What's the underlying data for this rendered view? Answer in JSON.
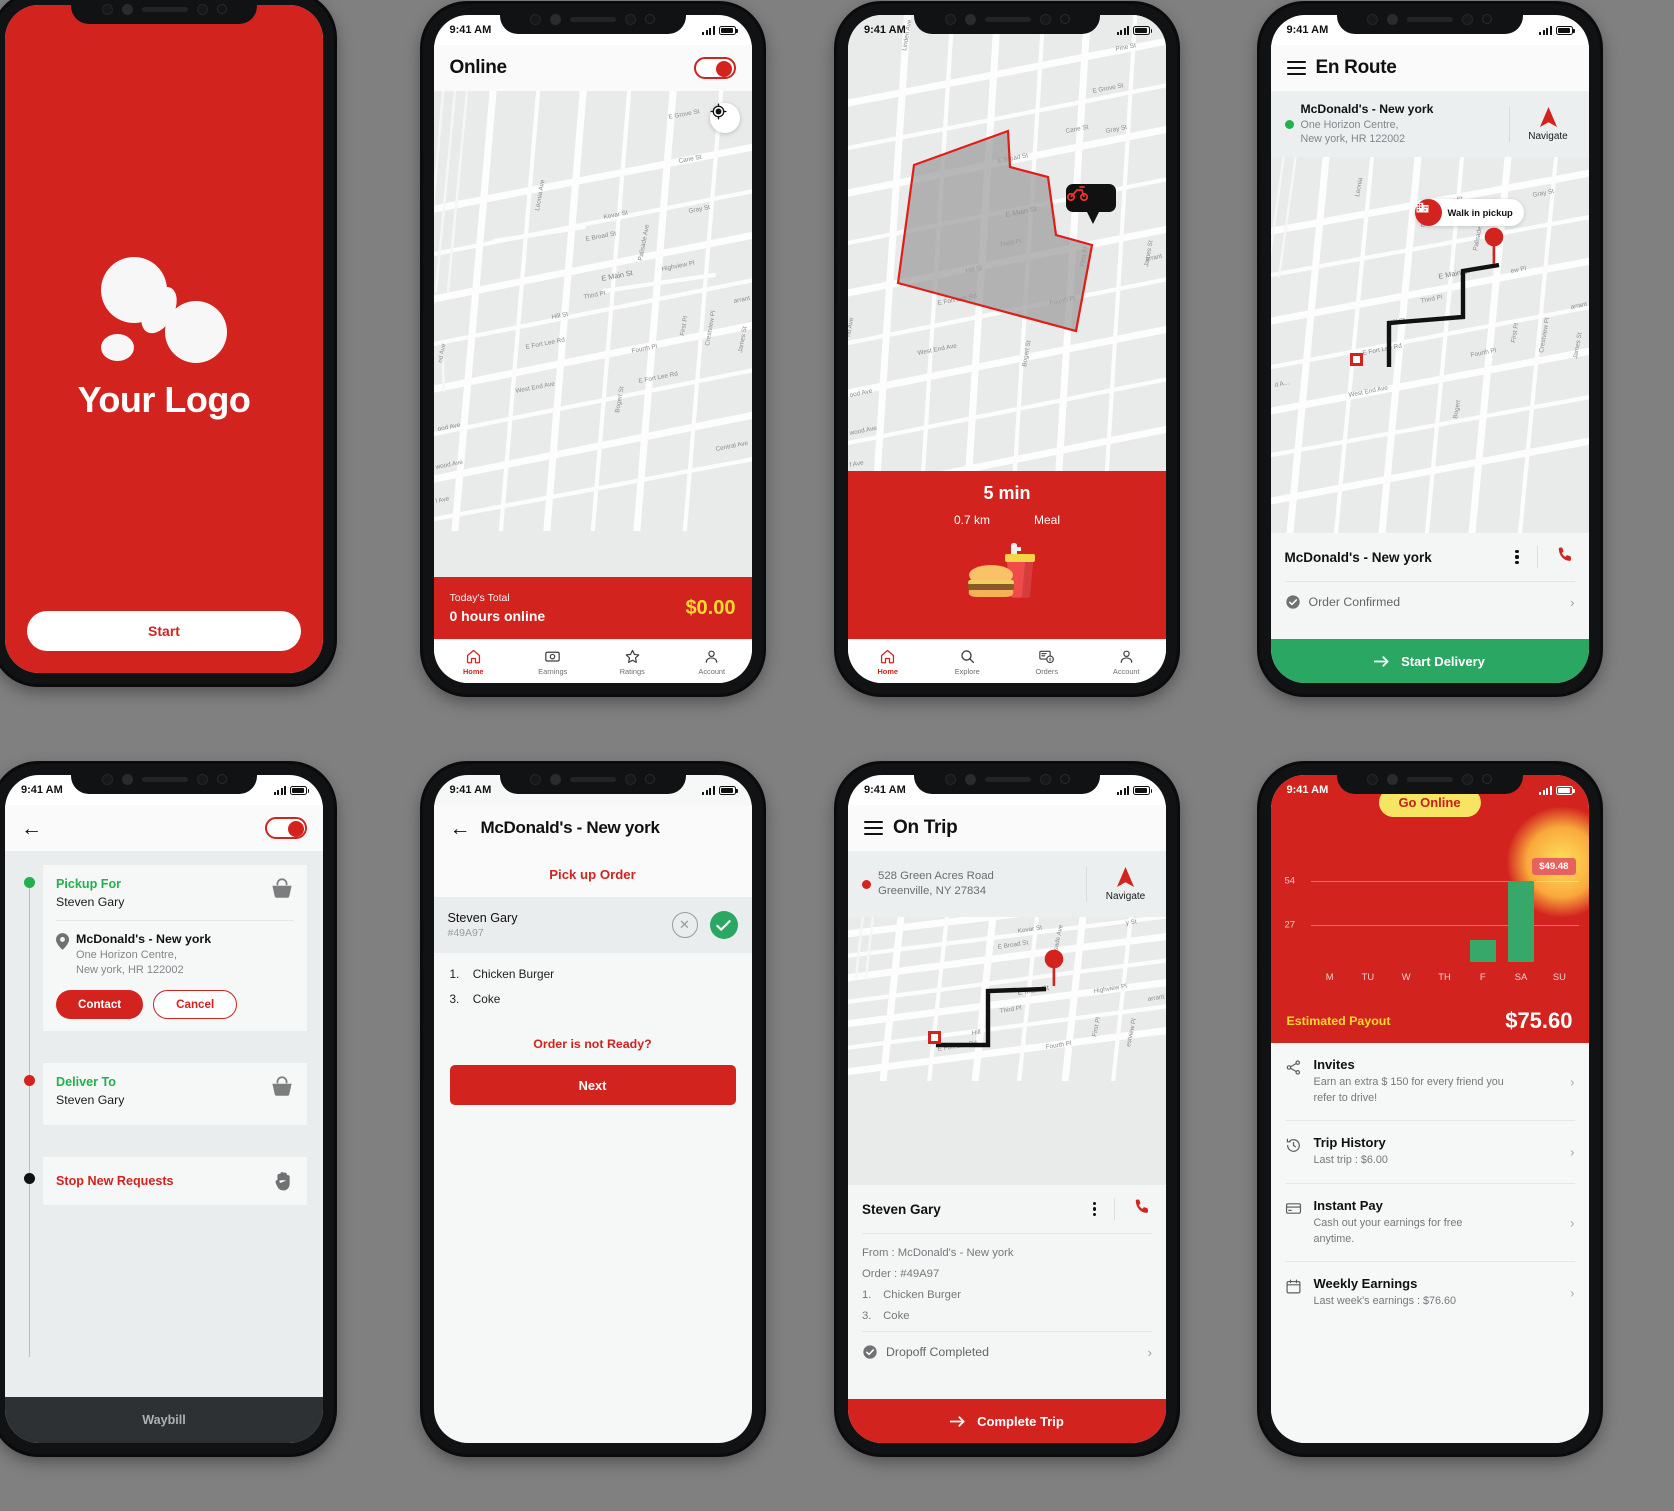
{
  "status_bar": {
    "time": "9:41 AM"
  },
  "screens": {
    "splash": {
      "logo_text": "Your Logo",
      "start_label": "Start",
      "brand_color": "#d2231f"
    },
    "online": {
      "title": "Online",
      "toggle_on": true,
      "today_total_label": "Today's Total",
      "hours_online": "0 hours online",
      "amount": "$0.00",
      "amount_color": "#ffd92e",
      "nav": [
        {
          "label": "Home",
          "icon": "home-icon",
          "active": true
        },
        {
          "label": "Earnings",
          "icon": "earnings-icon",
          "active": false
        },
        {
          "label": "Ratings",
          "icon": "star-icon",
          "active": false
        },
        {
          "label": "Account",
          "icon": "account-icon",
          "active": false
        }
      ]
    },
    "offer": {
      "duration": "5 min",
      "distance": "0.7 km",
      "category": "Meal",
      "nav": [
        {
          "label": "Home",
          "icon": "home-icon",
          "active": true
        },
        {
          "label": "Explore",
          "icon": "search-icon",
          "active": false
        },
        {
          "label": "Orders",
          "icon": "orders-icon",
          "active": false
        },
        {
          "label": "Account",
          "icon": "account-icon",
          "active": false
        }
      ]
    },
    "en_route": {
      "title": "En Route",
      "place": "McDonald's - New york",
      "address_line1": "One Horizon Centre,",
      "address_line2": "New york, HR 122002",
      "navigate_label": "Navigate",
      "map_pill": "Walk in pickup",
      "sheet_title": "McDonald's - New york",
      "status": "Order Confirmed",
      "cta": "Start Delivery",
      "cta_color": "#2aa863"
    },
    "waybill": {
      "pickup_title": "Pickup For",
      "pickup_name": "Steven Gary",
      "place": "McDonald's - New york",
      "address_line1": "One Horizon Centre,",
      "address_line2": "New york, HR 122002",
      "contact_label": "Contact",
      "cancel_label": "Cancel",
      "deliver_title": "Deliver To",
      "deliver_name": "Steven Gary",
      "stop_label": "Stop New Requests",
      "footer": "Waybill"
    },
    "pickup_order": {
      "title": "McDonald's - New york",
      "section": "Pick up Order",
      "customer": "Steven Gary",
      "order_id": "#49A97",
      "items": [
        {
          "num": "1.",
          "name": "Chicken Burger"
        },
        {
          "num": "3.",
          "name": "Coke"
        }
      ],
      "not_ready": "Order is not Ready?",
      "next_label": "Next"
    },
    "on_trip": {
      "title": "On Trip",
      "address_line1": "528 Green Acres Road",
      "address_line2": "Greenville, NY 27834",
      "navigate_label": "Navigate",
      "customer": "Steven Gary",
      "from_line": "From :  McDonald's - New york",
      "order_line": "Order :  #49A97",
      "items": [
        {
          "num": "1.",
          "name": "Chicken Burger"
        },
        {
          "num": "3.",
          "name": "Coke"
        }
      ],
      "status": "Dropoff Completed",
      "cta": "Complete Trip",
      "cta_color": "#d2231f"
    },
    "earnings": {
      "go_online_label": "Go Online",
      "tooltip": "$49.48",
      "payout_label": "Estimated Payout",
      "payout_amount": "$75.60",
      "menu": [
        {
          "icon": "share-icon",
          "title": "Invites",
          "sub": "Earn an extra $ 150 for every friend you refer to drive!"
        },
        {
          "icon": "history-icon",
          "title": "Trip History",
          "sub": "Last trip : $6.00"
        },
        {
          "icon": "card-icon",
          "title": "Instant Pay",
          "sub": "Cash out your earnings for free anytime."
        },
        {
          "icon": "calendar-icon",
          "title": "Weekly Earnings",
          "sub": "Last week's earnings : $76.60"
        }
      ]
    }
  },
  "chart_data": {
    "type": "bar",
    "title": "Weekly Earnings",
    "categories": [
      "M",
      "TU",
      "W",
      "TH",
      "F",
      "SA",
      "SU"
    ],
    "values": [
      0,
      0,
      0,
      0,
      12,
      49.48,
      0
    ],
    "ytick_labels": [
      "54",
      "27"
    ],
    "ylim": [
      0,
      62
    ],
    "bar_color": "#37a86a",
    "annotation": "$49.48",
    "xlabel": "",
    "ylabel": "",
    "grid": true,
    "legend": "none"
  },
  "map_labels": [
    "E Grove St",
    "Cane St",
    "Leonia Ave",
    "Kovar St",
    "Gray St",
    "E Broad St",
    "Palisade Ave",
    "Highview Pl",
    "E Main St",
    "Third Pl",
    "Hill St",
    "First Pl",
    "Crestview Pl",
    "James St",
    "E Fort Lee Rd",
    "Fourth Pl",
    "West End Ave",
    "Bogert St",
    "Central Ave",
    "Linden Ave",
    "Pine St",
    "wood Ave",
    "ood Ave",
    "Warrant"
  ]
}
